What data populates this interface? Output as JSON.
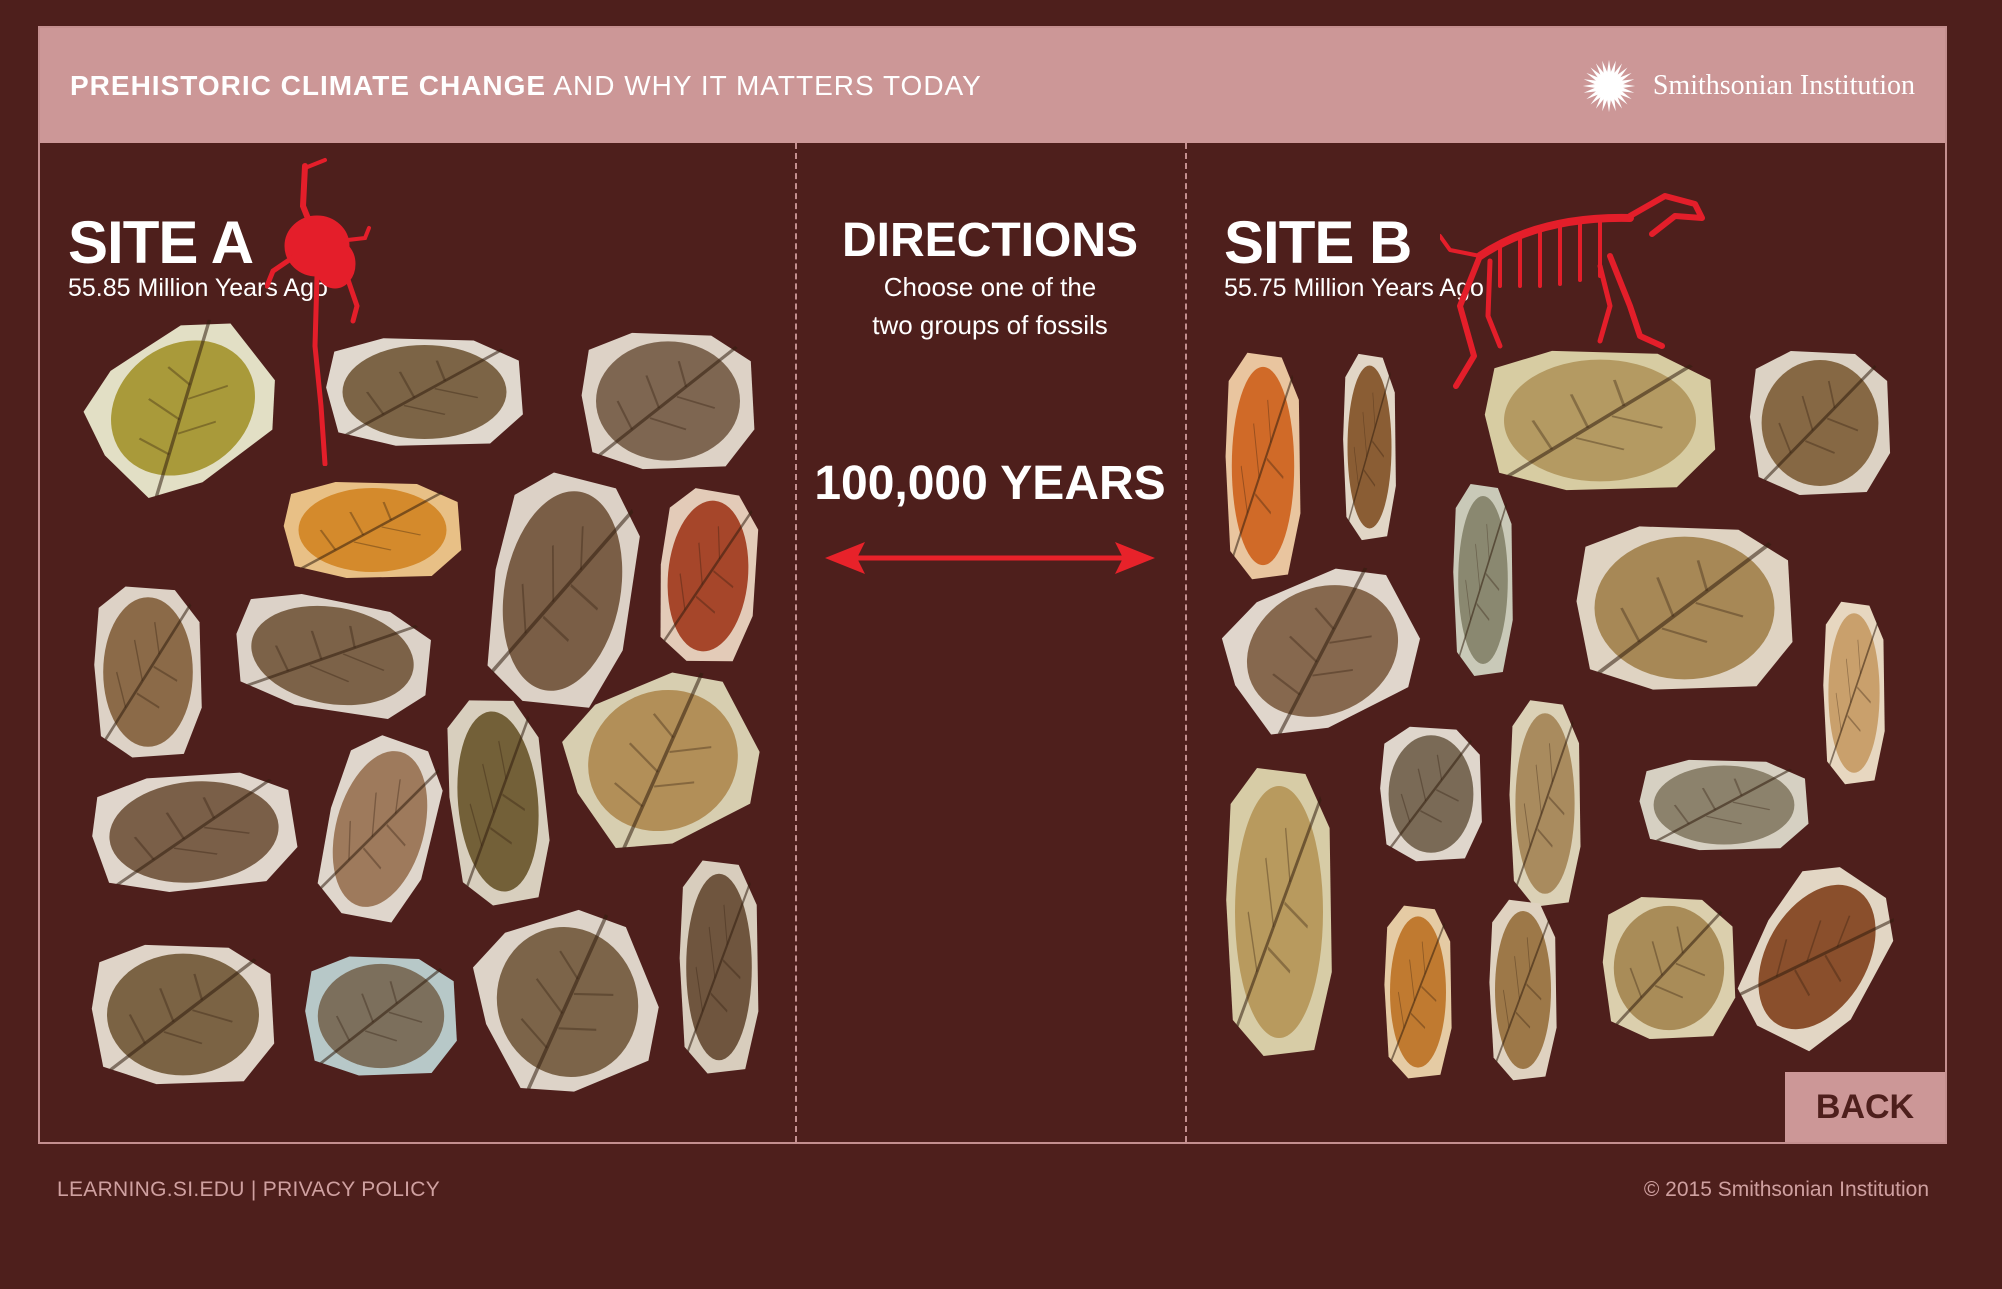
{
  "header": {
    "title_bold": "PREHISTORIC CLIMATE CHANGE",
    "title_light": "AND WHY IT MATTERS TODAY",
    "brand": "Smithsonian Institution"
  },
  "site_a": {
    "title": "SITE A",
    "subtitle": "55.85 Million Years Ago"
  },
  "site_b": {
    "title": "SITE B",
    "subtitle": "55.75 Million Years Ago"
  },
  "directions": {
    "heading": "DIRECTIONS",
    "line1": "Choose one of the",
    "line2": "two groups of fossils",
    "interval": "100,000 YEARS"
  },
  "back_label": "BACK",
  "footer": {
    "link1": "LEARNING.SI.EDU",
    "separator": "|",
    "link2": "PRIVACY POLICY",
    "copyright": "© 2015 Smithsonian Institution"
  },
  "colors": {
    "background": "#4e1f1c",
    "header": "#cc9797",
    "accent_red": "#e8222a",
    "text": "#ffffff"
  },
  "icons": {
    "brand": "sun-logo-icon",
    "arrow": "double-arrow-icon",
    "site_a_animal": "skeleton-site-a-icon",
    "site_b_animal": "skeleton-site-b-icon"
  }
}
